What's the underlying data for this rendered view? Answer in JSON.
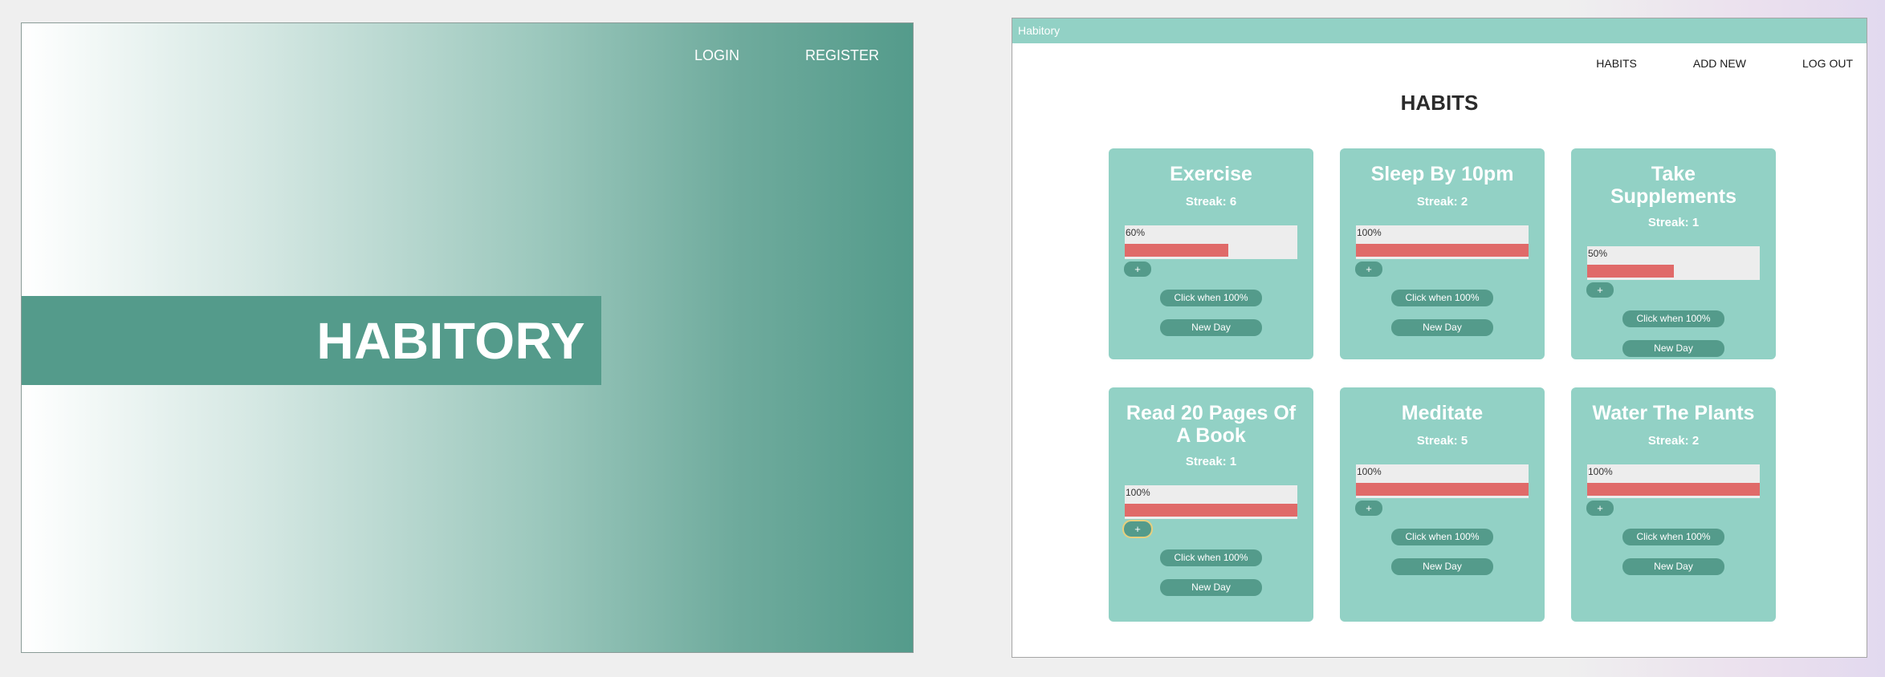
{
  "landing": {
    "nav": {
      "login": "LOGIN",
      "register": "REGISTER"
    },
    "hero_title": "HABITORY"
  },
  "app": {
    "window_title": "Habitory",
    "nav": {
      "habits": "HABITS",
      "add_new": "ADD NEW",
      "log_out": "LOG OUT"
    },
    "page_title": "HABITS",
    "plus_label": "+",
    "click_label": "Click when 100%",
    "new_day_label": "New Day",
    "habits": [
      {
        "title": "Exercise",
        "streak": "Streak: 6",
        "progress_label": "60%",
        "progress": 60
      },
      {
        "title": "Sleep By 10pm",
        "streak": "Streak: 2",
        "progress_label": "100%",
        "progress": 100
      },
      {
        "title": "Take Supplements",
        "streak": "Streak: 1",
        "progress_label": "50%",
        "progress": 50
      },
      {
        "title": "Read 20 Pages Of A Book",
        "streak": "Streak: 1",
        "progress_label": "100%",
        "progress": 100
      },
      {
        "title": "Meditate",
        "streak": "Streak: 5",
        "progress_label": "100%",
        "progress": 100
      },
      {
        "title": "Water The Plants",
        "streak": "Streak: 2",
        "progress_label": "100%",
        "progress": 100
      }
    ]
  },
  "colors": {
    "teal_dark": "#549b8b",
    "teal_light": "#92d1c5",
    "progress_fill": "#e06a69",
    "progress_track": "#ededed"
  }
}
